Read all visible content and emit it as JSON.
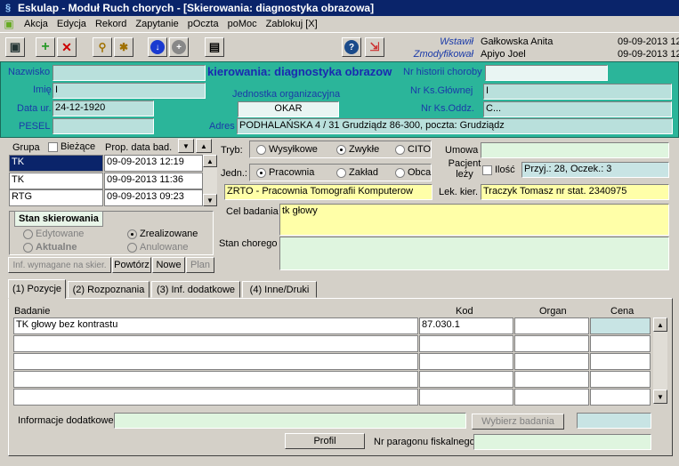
{
  "window": {
    "title": "Eskulap - Moduł Ruch chorych - [Skierowania: diagnostyka obrazowa]"
  },
  "menu": [
    "Akcja",
    "Edycja",
    "Rekord",
    "Zapytanie",
    "pOczta",
    "poMoc",
    "Zablokuj [X]"
  ],
  "toolbar": {
    "inserted_label": "Wstawił",
    "inserted_by": "Gałkowska Anita",
    "inserted_date": "09-09-2013 12",
    "modified_label": "Zmodyfikował",
    "modified_by": "Apiyo Joel",
    "modified_date": "09-09-2013 12"
  },
  "patient": {
    "surname_label": "Nazwisko",
    "surname": "",
    "form_title": "kierowania: diagnostyka obrazow",
    "history_label": "Nr historii choroby",
    "history": "",
    "name_label": "Imię",
    "name": "I",
    "unit_label": "Jednostka organizacyjna",
    "main_book_label": "Nr Ks.Głównej",
    "main_book": "I",
    "birth_label": "Data ur.",
    "birth": "24-12-1920",
    "unit": "OKAR",
    "dept_book_label": "Nr Ks.Oddz.",
    "dept_book": "C...",
    "pesel_label": "PESEL",
    "pesel": "",
    "address_label": "Adres",
    "address": "PODHALAŃSKA 4 / 31 Grudziądz 86-300, poczta: Grudziądz"
  },
  "left": {
    "group_label": "Grupa",
    "current_label": "Bieżące",
    "prop_date_label": "Prop. data bad.",
    "rows": [
      {
        "group": "TK",
        "date": "09-09-2013 12:19"
      },
      {
        "group": "TK",
        "date": "09-09-2013 11:36"
      },
      {
        "group": "RTG",
        "date": "09-09-2013 09:23"
      }
    ],
    "status_title": "Stan skierowania",
    "status_options": {
      "edited": "Edytowane",
      "current": "Aktualne",
      "done": "Zrealizowane",
      "cancelled": "Anulowane"
    },
    "buttons": {
      "inf": "Inf. wymagane na skier.",
      "repeat": "Powtórz",
      "new": "Nowe",
      "plan": "Plan"
    }
  },
  "form": {
    "mode_label": "Tryb:",
    "mode_opts": {
      "mail": "Wysyłkowe",
      "normal": "Zwykłe",
      "cito": "CITO"
    },
    "unit_label": "Jedn.:",
    "unit_opts": {
      "lab": "Pracownia",
      "facility": "Zakład",
      "other": "Obca"
    },
    "contract_label": "Umowa",
    "contract": "",
    "lying_label": "Pacjent leży",
    "qty_label": "Ilość",
    "admission": "Przyj.: 28, Oczek.: 3",
    "lab": "ZRTO - Pracownia Tomografii Komputerow",
    "doctor_label": "Lek. kier.",
    "doctor": "Traczyk Tomasz nr stat. 2340975",
    "purpose_label": "Cel badania",
    "purpose": "tk głowy",
    "condition_label": "Stan chorego",
    "condition": ""
  },
  "tabs": [
    "(1) Pozycje",
    "(2) Rozpoznania",
    "(3) Inf. dodatkowe",
    "(4) Inne/Druki"
  ],
  "grid": {
    "headers": {
      "test": "Badanie",
      "code": "Kod",
      "organ": "Organ",
      "price": "Cena"
    },
    "rows": [
      {
        "test": "TK głowy bez kontrastu",
        "code": "87.030.1",
        "organ": "",
        "price": ""
      }
    ]
  },
  "bottom": {
    "info_label": "Informacje dodatkowe",
    "info": "",
    "choose_button": "Wybierz badania",
    "profile_button": "Profil",
    "receipt_label": "Nr paragonu fiskalnego",
    "receipt": ""
  },
  "colors": {
    "title_bar": "#0a246a",
    "patient_panel": "#2bb59a",
    "highlight": "#ffffa8",
    "selected": "#0a246a"
  }
}
